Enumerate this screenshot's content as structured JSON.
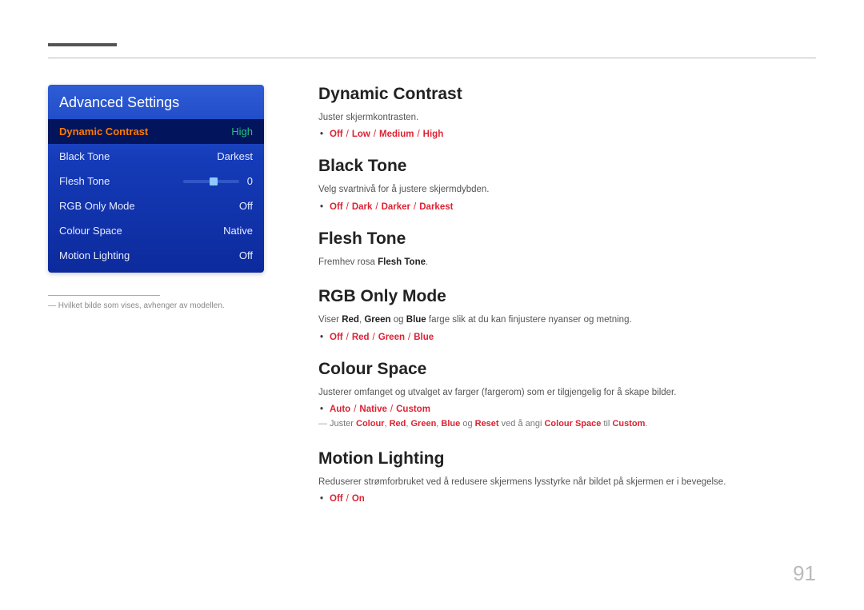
{
  "page_number": "91",
  "panel": {
    "title": "Advanced Settings",
    "rows": [
      {
        "label": "Dynamic Contrast",
        "value": "High"
      },
      {
        "label": "Black Tone",
        "value": "Darkest"
      },
      {
        "label": "Flesh Tone",
        "value": "0"
      },
      {
        "label": "RGB Only Mode",
        "value": "Off"
      },
      {
        "label": "Colour Space",
        "value": "Native"
      },
      {
        "label": "Motion Lighting",
        "value": "Off"
      }
    ]
  },
  "left_footnote": "Hvilket bilde som vises, avhenger av modellen.",
  "sections": {
    "dynamic_contrast": {
      "heading": "Dynamic Contrast",
      "desc": "Juster skjermkontrasten.",
      "options": [
        "Off",
        "Low",
        "Medium",
        "High"
      ]
    },
    "black_tone": {
      "heading": "Black Tone",
      "desc": "Velg svartnivå for å justere skjermdybden.",
      "options": [
        "Off",
        "Dark",
        "Darker",
        "Darkest"
      ]
    },
    "flesh_tone": {
      "heading": "Flesh Tone",
      "desc_pre": "Fremhev rosa ",
      "desc_bold": "Flesh Tone",
      "desc_post": "."
    },
    "rgb_only": {
      "heading": "RGB Only Mode",
      "desc_pre": "Viser ",
      "w_red": "Red",
      "sep1": ", ",
      "w_green": "Green",
      "sep2": " og ",
      "w_blue": "Blue",
      "desc_post": " farge slik at du kan finjustere nyanser og metning.",
      "options": [
        "Off",
        "Red",
        "Green",
        "Blue"
      ]
    },
    "colour_space": {
      "heading": "Colour Space",
      "desc": "Justerer omfanget og utvalget av farger (fargerom) som er tilgjengelig for å skape bilder.",
      "options": [
        "Auto",
        "Native",
        "Custom"
      ],
      "note_pre": "Juster ",
      "n_colour": "Colour",
      "c1": ", ",
      "n_red": "Red",
      "c2": ", ",
      "n_green": "Green",
      "c3": ", ",
      "n_blue": "Blue",
      "c4": " og ",
      "n_reset": "Reset",
      "mid": " ved å angi ",
      "n_cs": "Colour Space",
      "mid2": " til ",
      "n_custom": "Custom",
      "end": "."
    },
    "motion_lighting": {
      "heading": "Motion Lighting",
      "desc": "Reduserer strømforbruket ved å redusere skjermens lysstyrke når bildet på skjermen er i bevegelse.",
      "options": [
        "Off",
        "On"
      ]
    }
  }
}
